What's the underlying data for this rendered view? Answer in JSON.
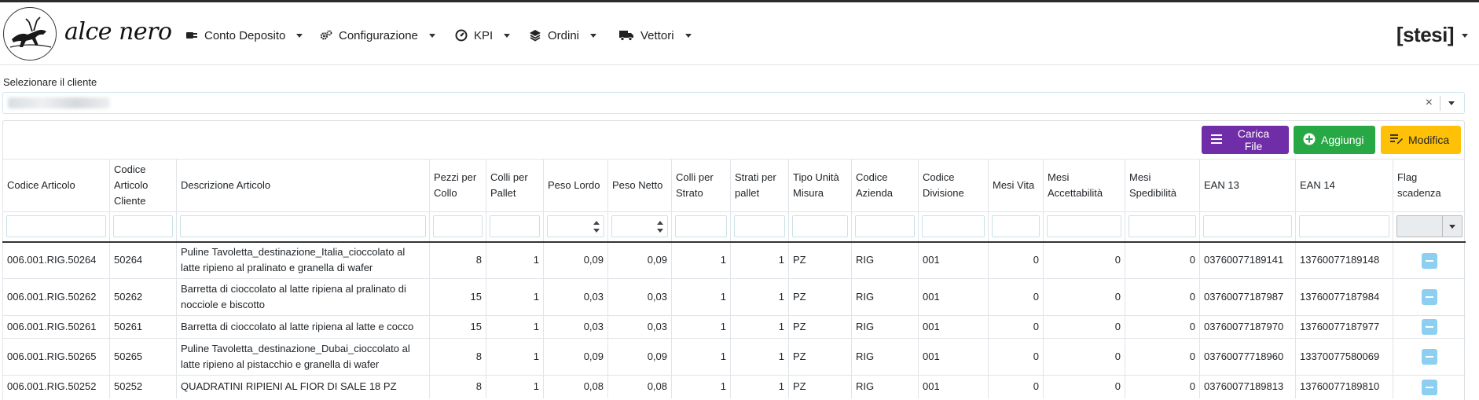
{
  "navbar": {
    "logo_text": "alce nero",
    "menu": [
      {
        "label": "Conto Deposito",
        "icon": "plug-icon"
      },
      {
        "label": "Configurazione",
        "icon": "cogs-icon"
      },
      {
        "label": "KPI",
        "icon": "gauge-icon"
      },
      {
        "label": "Ordini",
        "icon": "layers-icon"
      },
      {
        "label": "Vettori",
        "icon": "truck-icon"
      }
    ],
    "brand_right": "[stesi]"
  },
  "client": {
    "label": "Selezionare il cliente",
    "clear": "×"
  },
  "toolbar": {
    "carica_label": "Carica File",
    "aggiungi_label": "Aggiungi",
    "modifica_label": "Modifica"
  },
  "colors": {
    "carica": "#6f2da8",
    "aggiungi": "#28a745",
    "modifica": "#ffc107",
    "flag": "#8dcff0"
  },
  "table": {
    "columns": [
      "Codice Articolo",
      "Codice Articolo Cliente",
      "Descrizione Articolo",
      "Pezzi per Collo",
      "Colli per Pallet",
      "Peso Lordo",
      "Peso Netto",
      "Colli per Strato",
      "Strati per pallet",
      "Tipo Unità Misura",
      "Codice Azienda",
      "Codice Divisione",
      "Mesi Vita",
      "Mesi Accettabilità",
      "Mesi Spedibilità",
      "EAN 13",
      "EAN 14",
      "Flag scadenza"
    ],
    "rows": [
      [
        "006.001.RIG.50264",
        "50264",
        "Puline Tavoletta_destinazione_Italia_cioccolato al latte ripieno al pralinato e granella di wafer",
        "8",
        "1",
        "0,09",
        "0,09",
        "1",
        "1",
        "PZ",
        "RIG",
        "001",
        "0",
        "0",
        "0",
        "03760077189141",
        "13760077189148"
      ],
      [
        "006.001.RIG.50262",
        "50262",
        "Barretta di cioccolato al latte ripiena al pralinato di nocciole e biscotto",
        "15",
        "1",
        "0,03",
        "0,03",
        "1",
        "1",
        "PZ",
        "RIG",
        "001",
        "0",
        "0",
        "0",
        "03760077187987",
        "13760077187984"
      ],
      [
        "006.001.RIG.50261",
        "50261",
        "Barretta di cioccolato al latte ripiena al latte e cocco",
        "15",
        "1",
        "0,03",
        "0,03",
        "1",
        "1",
        "PZ",
        "RIG",
        "001",
        "0",
        "0",
        "0",
        "03760077187970",
        "13760077187977"
      ],
      [
        "006.001.RIG.50265",
        "50265",
        "Puline Tavoletta_destinazione_Dubai_cioccolato al latte ripieno al pistacchio e granella di wafer",
        "8",
        "1",
        "0,09",
        "0,09",
        "1",
        "1",
        "PZ",
        "RIG",
        "001",
        "0",
        "0",
        "0",
        "03760077718960",
        "13370077580069"
      ],
      [
        "006.001.RIG.50252",
        "50252",
        "QUADRATINI RIPIENI AL FIOR DI SALE 18 PZ",
        "8",
        "1",
        "0,08",
        "0,08",
        "1",
        "1",
        "PZ",
        "RIG",
        "001",
        "0",
        "0",
        "0",
        "03760077189813",
        "13760077189810"
      ]
    ]
  }
}
